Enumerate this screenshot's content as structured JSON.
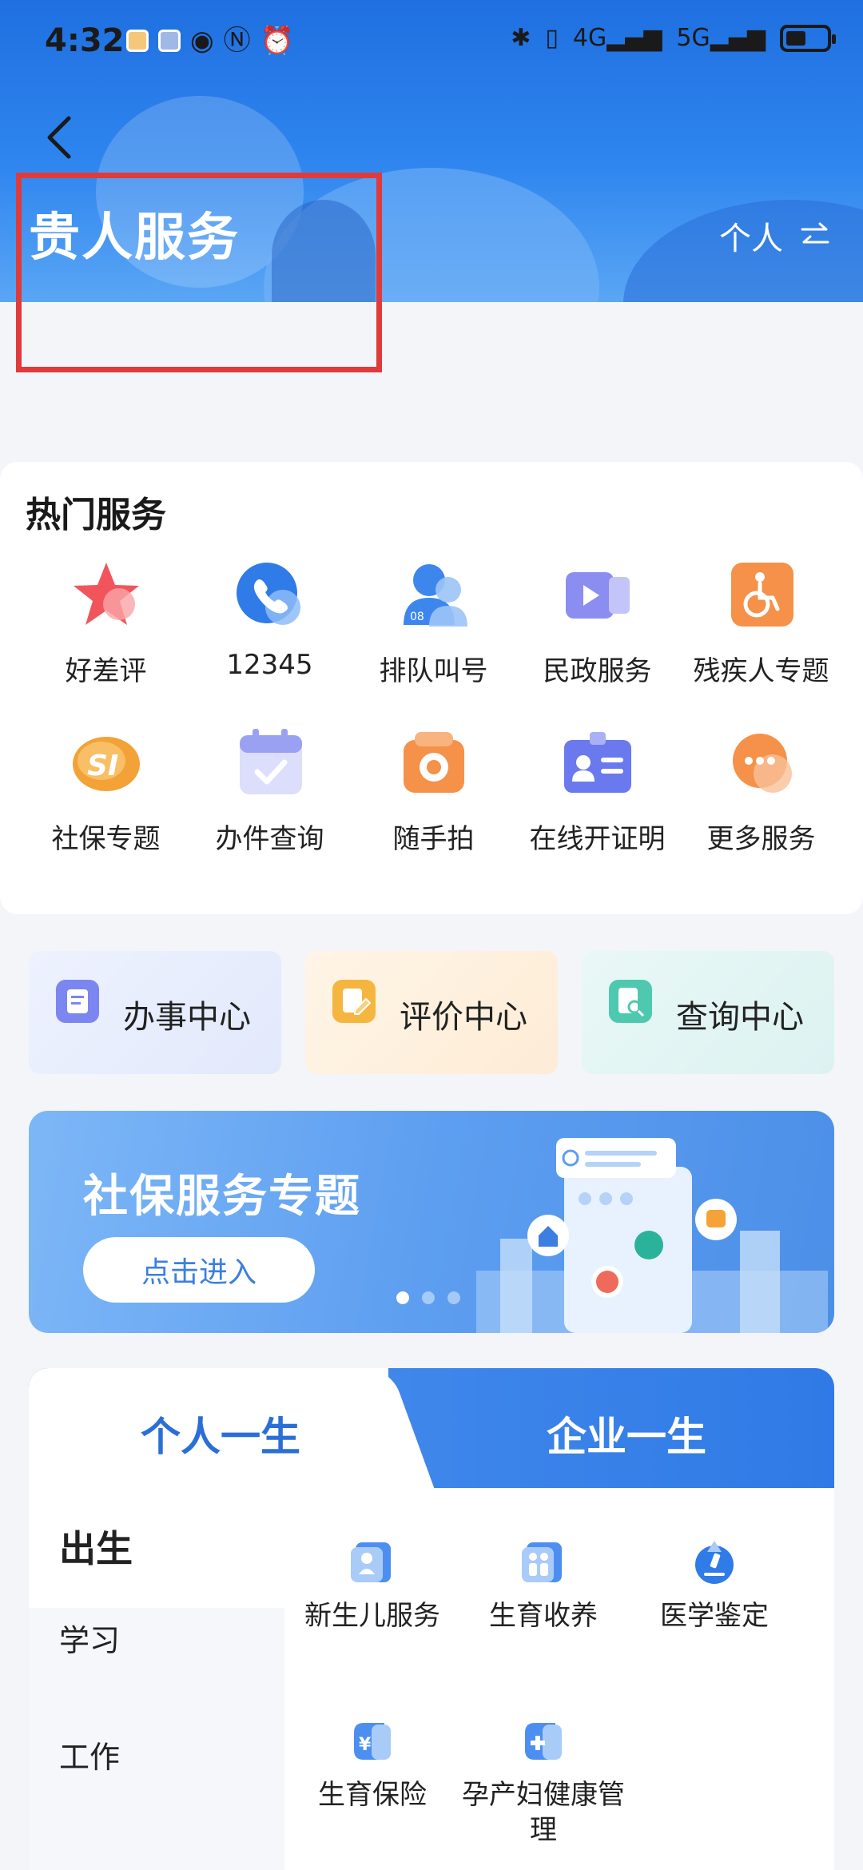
{
  "status_bar": {
    "time": "4:32",
    "network1": "4G",
    "network2": "5G"
  },
  "header": {
    "title": "贵人服务",
    "switch_label": "个人",
    "switch_icon": "swap-icon"
  },
  "hot_services": {
    "title": "热门服务",
    "items": [
      {
        "label": "好差评",
        "icon": "star-icon",
        "color": "#f2545b"
      },
      {
        "label": "12345",
        "icon": "phone-icon",
        "color": "#2f7be8"
      },
      {
        "label": "排队叫号",
        "icon": "user-queue-icon",
        "color": "#3d86ee"
      },
      {
        "label": "民政服务",
        "icon": "video-icon",
        "color": "#8b8ef0"
      },
      {
        "label": "残疾人专题",
        "icon": "wheelchair-icon",
        "color": "#f59148"
      },
      {
        "label": "社保专题",
        "icon": "social-security-icon",
        "color": "#f2a236"
      },
      {
        "label": "办件查询",
        "icon": "calendar-check-icon",
        "color": "#9aa0f2"
      },
      {
        "label": "随手拍",
        "icon": "camera-icon",
        "color": "#f59148"
      },
      {
        "label": "在线开证明",
        "icon": "id-card-icon",
        "color": "#6b79ee"
      },
      {
        "label": "更多服务",
        "icon": "more-chat-icon",
        "color": "#f59148"
      }
    ]
  },
  "centers": [
    {
      "label": "办事中心",
      "color": "#7b86f0"
    },
    {
      "label": "评价中心",
      "color": "#f5b640"
    },
    {
      "label": "查询中心",
      "color": "#4ec9b0"
    }
  ],
  "banner": {
    "title": "社保服务专题",
    "button": "点击进入"
  },
  "life": {
    "tab_personal": "个人一生",
    "tab_enterprise": "企业一生",
    "sidebar": [
      "出生",
      "学习",
      "工作"
    ],
    "items": [
      {
        "label": "新生儿服务",
        "icon": "baby-icon"
      },
      {
        "label": "生育收养",
        "icon": "family-icon"
      },
      {
        "label": "医学鉴定",
        "icon": "microscope-icon"
      },
      {
        "label": "生育保险",
        "icon": "insurance-icon"
      },
      {
        "label": "孕产妇健康管理",
        "icon": "health-icon"
      }
    ]
  }
}
